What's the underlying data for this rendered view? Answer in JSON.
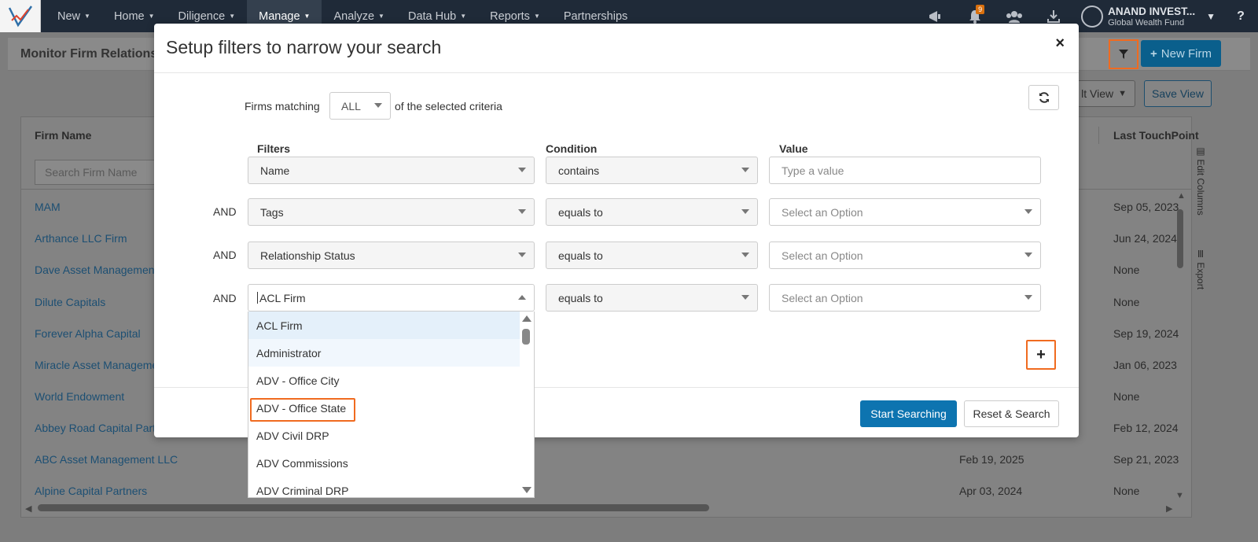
{
  "nav": {
    "menu": [
      {
        "label": "New"
      },
      {
        "label": "Home"
      },
      {
        "label": "Diligence"
      },
      {
        "label": "Manage",
        "active": true
      },
      {
        "label": "Analyze"
      },
      {
        "label": "Data Hub"
      },
      {
        "label": "Reports"
      },
      {
        "label": "Partnerships"
      }
    ],
    "notification_count": "9",
    "user": {
      "name": "ANAND INVEST...",
      "org": "Global Wealth Fund"
    },
    "help": "?"
  },
  "page": {
    "title": "Monitor Firm Relations",
    "new_firm_label": "New Firm",
    "view_label": "lt View",
    "save_view_label": "Save View",
    "grid": {
      "col_firm_name": "Firm Name",
      "col_last_touchpoint": "Last TouchPoint",
      "search_placeholder": "Search Firm Name",
      "edit_columns": "Edit Columns",
      "export": "Export",
      "rows": [
        {
          "name": "MAM",
          "date1": "",
          "date2": "Sep 05, 2023"
        },
        {
          "name": "Arthance LLC Firm",
          "date1": "",
          "date2": "Jun 24, 2024"
        },
        {
          "name": "Dave Asset Management",
          "date1": "",
          "date2": "None"
        },
        {
          "name": "Dilute Capitals",
          "date1": "",
          "date2": "None"
        },
        {
          "name": "Forever Alpha Capital",
          "date1": "",
          "date2": "Sep 19, 2024"
        },
        {
          "name": "Miracle Asset Manageme",
          "date1": "",
          "date2": "Jan 06, 2023"
        },
        {
          "name": "World Endowment",
          "date1": "",
          "date2": "None"
        },
        {
          "name": "Abbey Road Capital Partn",
          "date1": "",
          "date2": "Feb 12, 2024"
        },
        {
          "name": "ABC Asset Management LLC",
          "date1": "Feb 19, 2025",
          "date2": "Sep 21, 2023"
        },
        {
          "name": "Alpine Capital Partners",
          "date1": "Apr 03, 2024",
          "date2": "None"
        }
      ]
    }
  },
  "modal": {
    "title": "Setup filters to narrow your search",
    "close": "×",
    "matching_prefix": "Firms matching",
    "matching_value": "ALL",
    "matching_suffix": "of the selected criteria",
    "col_filters": "Filters",
    "col_condition": "Condition",
    "col_value": "Value",
    "and_label": "AND",
    "rows": [
      {
        "filter": "Name",
        "condition": "contains",
        "value_placeholder": "Type a value"
      },
      {
        "filter": "Tags",
        "condition": "equals to",
        "value_placeholder": "Select an Option"
      },
      {
        "filter": "Relationship Status",
        "condition": "equals to",
        "value_placeholder": "Select an Option"
      },
      {
        "filter": "ACL Firm",
        "condition": "equals to",
        "value_placeholder": "Select an Option"
      }
    ],
    "add_label": "+",
    "start_label": "Start Searching",
    "reset_label": "Reset & Search"
  },
  "dropdown": {
    "options": [
      "ACL Firm",
      "Administrator",
      "ADV - Office City",
      "ADV - Office State",
      "ADV Civil DRP",
      "ADV Commissions",
      "ADV Criminal DRP"
    ],
    "highlighted": "ADV - Office State"
  },
  "colors": {
    "nav_bg": "#1f2a38",
    "primary": "#0d74b0",
    "highlight_outline": "#f06b20",
    "link": "#1c4f73"
  }
}
